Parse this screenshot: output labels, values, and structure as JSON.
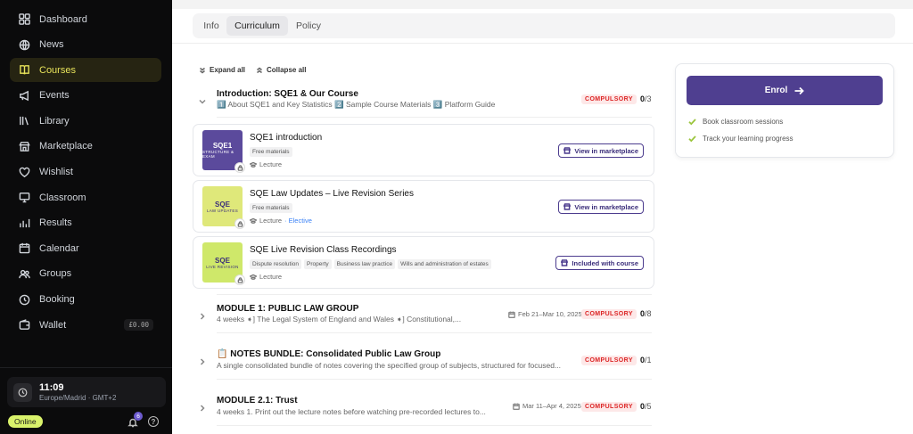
{
  "sidebar": {
    "items": [
      {
        "label": "Dashboard",
        "icon": "grid-icon"
      },
      {
        "label": "News",
        "icon": "globe-icon"
      },
      {
        "label": "Courses",
        "icon": "book-icon"
      },
      {
        "label": "Events",
        "icon": "megaphone-icon"
      },
      {
        "label": "Library",
        "icon": "library-icon"
      },
      {
        "label": "Marketplace",
        "icon": "store-icon"
      },
      {
        "label": "Wishlist",
        "icon": "heart-icon"
      },
      {
        "label": "Classroom",
        "icon": "monitor-icon"
      },
      {
        "label": "Results",
        "icon": "bar-chart-icon"
      },
      {
        "label": "Calendar",
        "icon": "calendar-icon"
      },
      {
        "label": "Groups",
        "icon": "groups-icon"
      },
      {
        "label": "Booking",
        "icon": "clock-icon"
      },
      {
        "label": "Wallet",
        "icon": "wallet-icon"
      }
    ],
    "active": "Courses",
    "wallet_amount": "£0.00",
    "clock_time": "11:09",
    "clock_tz": "Europe/Madrid · GMT+2",
    "status": "Online",
    "notif_count": "6"
  },
  "tabs": [
    {
      "label": "Info"
    },
    {
      "label": "Curriculum"
    },
    {
      "label": "Policy"
    }
  ],
  "active_tab": "Curriculum",
  "controls": {
    "expand_all": "Expand all",
    "collapse_all": "Collapse all"
  },
  "intro": {
    "title": "Introduction: SQE1 & Our Course",
    "desc": "1️⃣ About SQE1 and Key Statistics 2️⃣ Sample Course Materials 3️⃣ Platform Guide",
    "badge": "COMPULSORY",
    "done": "0",
    "total": "/3"
  },
  "lessons": [
    {
      "title": "SQE1 introduction",
      "tags": [
        "Free materials"
      ],
      "type": "Lecture",
      "elective": "",
      "button": "View in marketplace",
      "thumb_top": "SQE1",
      "thumb_bottom": "STRUCTURE & EXAM",
      "thumb_color": "#5b4a9c"
    },
    {
      "title": "SQE Law Updates – Live Revision Series",
      "tags": [
        "Free materials"
      ],
      "type": "Lecture",
      "elective": "· Elective",
      "button": "View in marketplace",
      "thumb_top": "SQE",
      "thumb_bottom": "LAW UPDATES",
      "thumb_color": "#dfe87a"
    },
    {
      "title": "SQE Live Revision Class Recordings",
      "tags": [
        "Dispute resolution",
        "Property",
        "Business law practice",
        "Wills and administration of estates"
      ],
      "type": "Lecture",
      "elective": "",
      "button": "Included with course",
      "thumb_top": "SQE",
      "thumb_bottom": "LIVE REVISION",
      "thumb_color": "#cfe86a"
    }
  ],
  "modules": [
    {
      "title": "MODULE 1: PUBLIC LAW GROUP",
      "desc": "4 weeks ➧] The Legal System of England and Wales ➧] Constitutional,...",
      "date": "Feb 21–Mar 10, 2025",
      "badge": "COMPULSORY",
      "done": "0",
      "total": "/8"
    },
    {
      "title": "📋 NOTES BUNDLE: Consolidated Public Law Group",
      "desc": "A single consolidated bundle of notes covering the specified group of subjects, structured for focused...",
      "date": "",
      "badge": "COMPULSORY",
      "done": "0",
      "total": "/1"
    },
    {
      "title": "MODULE 2.1: Trust",
      "desc": "4 weeks 1. Print out the lecture notes before watching pre-recorded lectures to...",
      "date": "Mar 11–Apr 4, 2025",
      "badge": "COMPULSORY",
      "done": "0",
      "total": "/5"
    }
  ],
  "enrol": {
    "button": "Enrol",
    "perks": [
      "Book classroom sessions",
      "Track your learning progress"
    ]
  }
}
